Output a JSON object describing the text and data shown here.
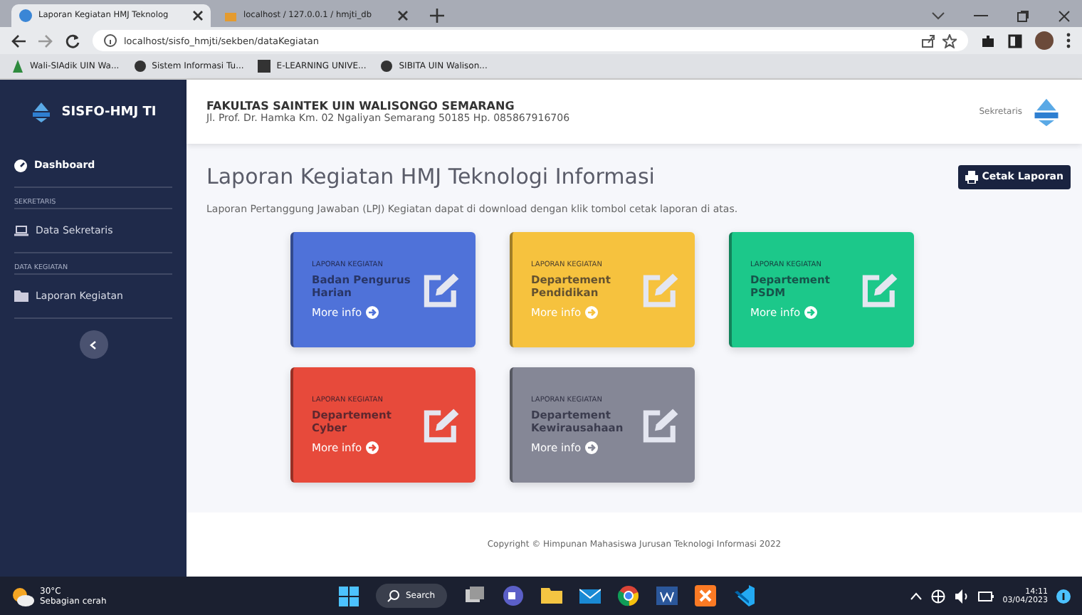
{
  "browser": {
    "tabs": [
      {
        "label": "Laporan Kegiatan HMJ Teknolog",
        "selected": true
      },
      {
        "label": "localhost / 127.0.0.1 / hmjti_db",
        "selected": false
      }
    ],
    "address": "localhost/sisfo_hmjti/sekben/dataKegiatan",
    "bookmarks": [
      "Wali-SIAdik UIN Wa...",
      "Sistem Informasi Tu...",
      "E-LEARNING UNIVE...",
      "SIBITA UIN Walison..."
    ]
  },
  "sidebar": {
    "brand": "SISFO-HMJ TI",
    "items": [
      {
        "kind": "link",
        "label": "Dashboard",
        "selected": true
      },
      {
        "kind": "heading",
        "label": "SEKRETARIS"
      },
      {
        "kind": "link",
        "label": "Data Sekretaris",
        "selected": false
      },
      {
        "kind": "heading",
        "label": "DATA KEGIATAN"
      },
      {
        "kind": "link",
        "label": "Laporan Kegiatan",
        "selected": false
      }
    ]
  },
  "header": {
    "institution": "FAKULTAS SAINTEK UIN WALISONGO SEMARANG",
    "address": "Jl. Prof. Dr. Hamka Km. 02 Ngaliyan Semarang 50185 Hp. 085867916706",
    "user": "Sekretaris"
  },
  "page": {
    "title": "Laporan Kegiatan HMJ Teknologi Informasi",
    "print_button": "Cetak Laporan",
    "description": "Laporan Pertanggung Jawaban (LPJ) Kegiatan dapat di download dengan klik tombol cetak laporan di atas.",
    "cards": [
      {
        "caption": "LAPORAN KEGIATAN",
        "title": "Badan Pengurus Harian",
        "link": "More info",
        "color": "#4f72d9"
      },
      {
        "caption": "LAPORAN KEGIATAN",
        "title": "Departement Pendidikan",
        "link": "More info",
        "color": "#f6c23e"
      },
      {
        "caption": "LAPORAN KEGIATAN",
        "title": "Departement PSDM",
        "link": "More info",
        "color": "#1cc88a"
      },
      {
        "caption": "LAPORAN KEGIATAN",
        "title": "Departement Cyber",
        "link": "More info",
        "color": "#e74a3b"
      },
      {
        "caption": "LAPORAN KEGIATAN",
        "title": "Departement Kewirausahaan",
        "link": "More info",
        "color": "#858796"
      }
    ]
  },
  "footer": "Copyright © Himpunan Mahasiswa Jurusan Teknologi Informasi 2022",
  "taskbar": {
    "temperature": "30°C",
    "weather": "Sebagian cerah",
    "search": "Search",
    "time": "14:11",
    "date": "03/04/2023"
  }
}
